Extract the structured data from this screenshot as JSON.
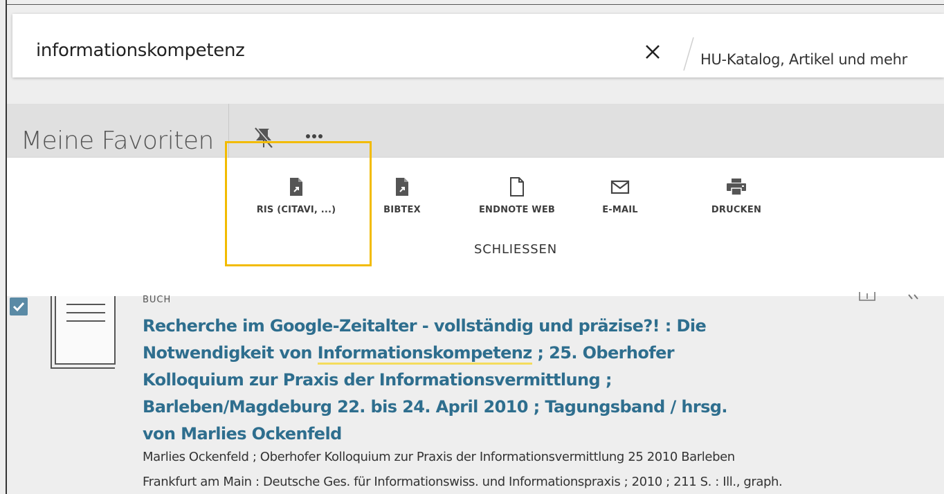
{
  "search": {
    "query": "informationskompetenz",
    "scope": "HU-Katalog, Artikel und mehr"
  },
  "favorites": {
    "title": "Meine Favoriten"
  },
  "actions": {
    "ris": "RIS (CITAVI, ...)",
    "bibtex": "BIBTEX",
    "endnote": "ENDNOTE WEB",
    "email": "E-MAIL",
    "print": "DRUCKEN",
    "close": "SCHLIESSEN"
  },
  "result": {
    "type": "BUCH",
    "checked": true,
    "title_part1": "Recherche im Google-Zeitalter - vollständig und präzise?! : Die Notwendigkeit von ",
    "title_highlight": "Informationskompetenz",
    "title_part2": " ; 25. Oberhofer Kolloquium zur Praxis der Informationsvermittlung ; Barleben/Magdeburg 22. bis 24. April 2010 ; Tagungsband / hrsg. von Marlies Ockenfeld",
    "authors": "Marlies Ockenfeld ; Oberhofer Kolloquium zur Praxis der Informationsvermittlung 25 2010 Barleben",
    "publisher": "Frankfurt am Main : Deutsche Ges. für Informationswiss. und Informationspraxis ; 2010 ; 211 S. : Ill., graph."
  },
  "colors": {
    "highlight_border": "#f2bb00",
    "title_link": "#2e6e8e",
    "checkbox": "#5a8aa5",
    "term_underline": "#f4dc5c"
  },
  "icons": {
    "clear": "close-icon",
    "unpin": "unpin-icon",
    "more": "more-icon",
    "ris": "file-export-icon",
    "bibtex": "file-export-icon",
    "endnote": "file-icon",
    "email": "envelope-icon",
    "print": "printer-icon"
  }
}
